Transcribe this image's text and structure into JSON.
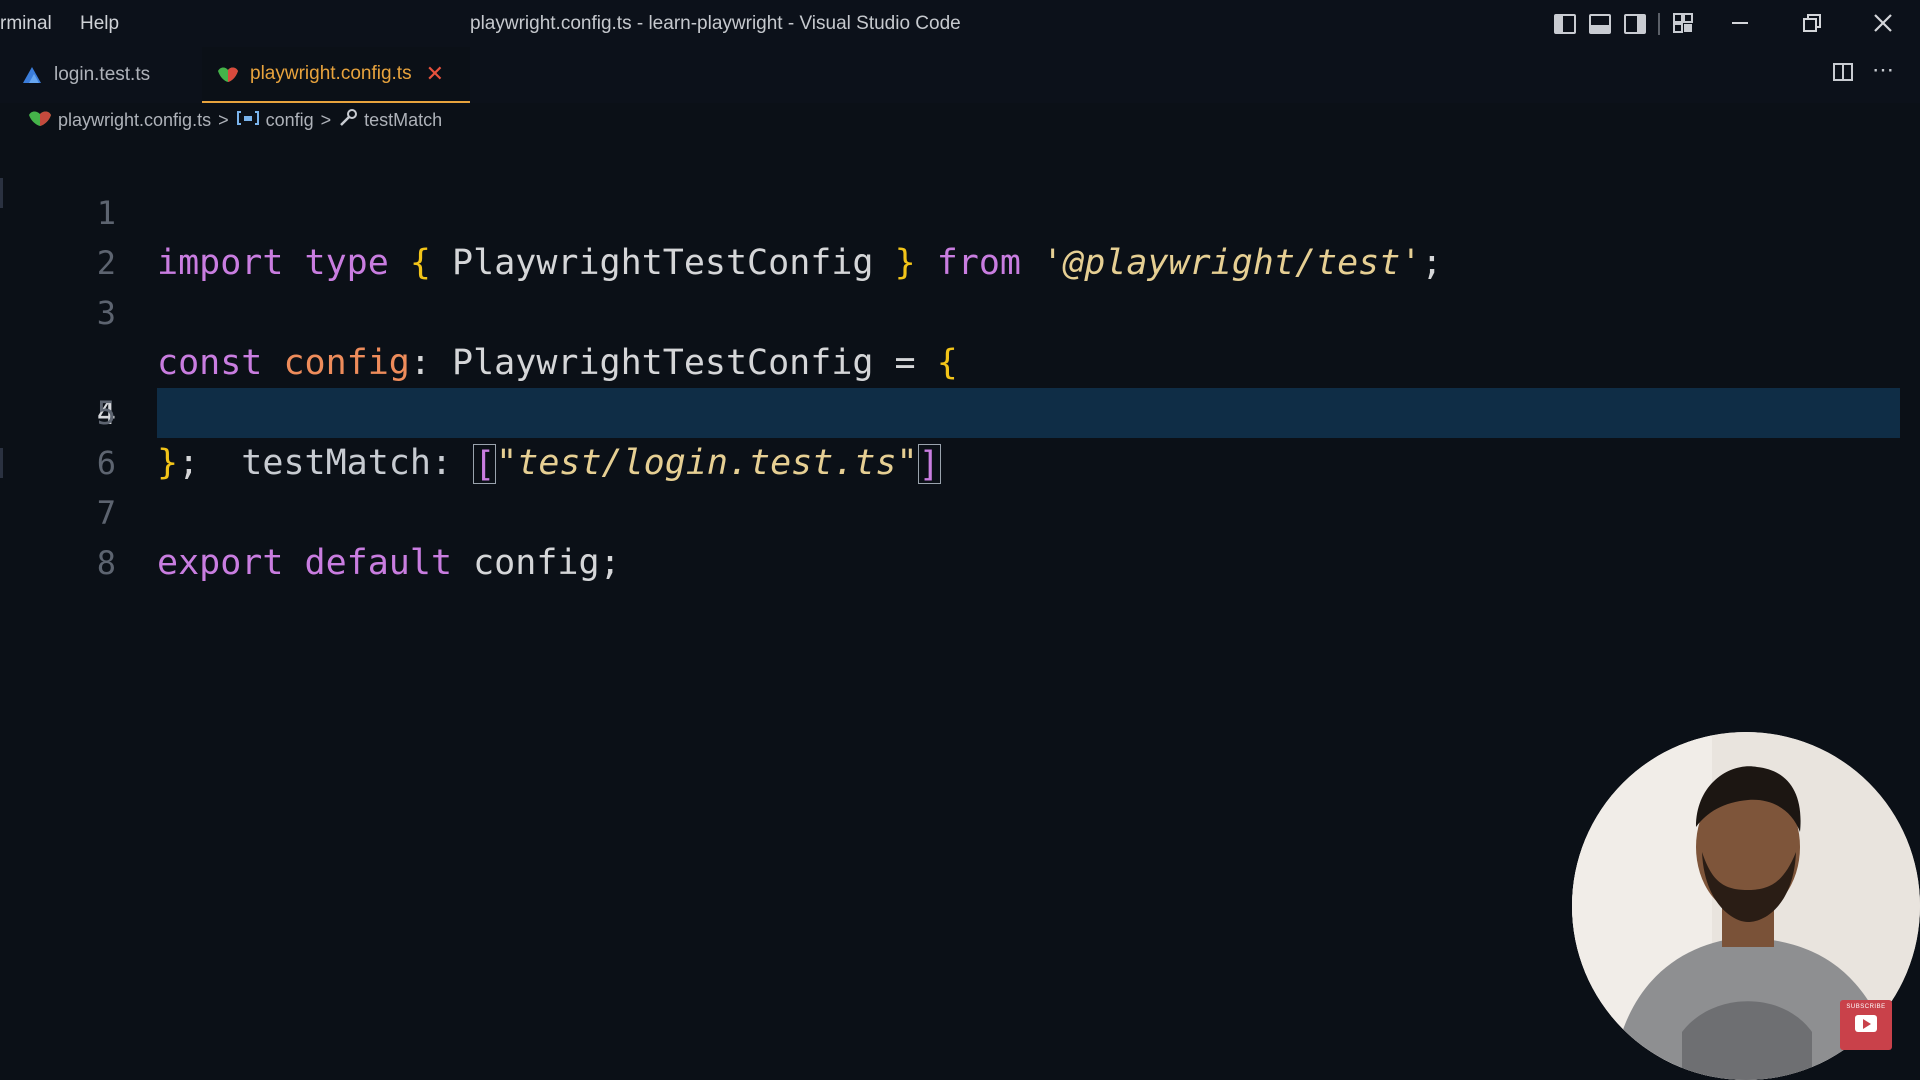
{
  "menu": {
    "terminal": "rminal",
    "help": "Help"
  },
  "window": {
    "title": "playwright.config.ts - learn-playwright - Visual Studio Code"
  },
  "tabs": [
    {
      "label": "login.test.ts",
      "icon": "test-file-icon",
      "active": false
    },
    {
      "label": "playwright.config.ts",
      "icon": "playwright-icon",
      "active": true
    }
  ],
  "breadcrumb": {
    "file": "playwright.config.ts",
    "symbol": "config",
    "property": "testMatch",
    "separator": ">"
  },
  "editor": {
    "active_line": 4,
    "line_numbers": [
      "1",
      "2",
      "3",
      "4",
      "5",
      "6",
      "7",
      "8"
    ],
    "line1": {
      "import": "import",
      "type": "type",
      "open": "{",
      "name": "PlaywrightTestConfig",
      "close": "}",
      "from": "from",
      "module": "'@playwright/test'",
      "semi": ";"
    },
    "line3": {
      "const": "const",
      "name": "config",
      "colon": ":",
      "type": "PlaywrightTestConfig",
      "eq": "=",
      "open": "{"
    },
    "line4": {
      "prop": "testMatch:",
      "lbracket": "[",
      "value": "\"test/login.test.ts\"",
      "rbracket": "]"
    },
    "line5": {
      "close": "}",
      "semi": ";"
    },
    "line7": {
      "export": "export",
      "default": "default",
      "name": "config;"
    }
  },
  "colors": {
    "background": "#0b1017",
    "accent_tab": "#e8a33d",
    "keyword": "#c97de0",
    "brace": "#f2c419",
    "variable": "#ee8c5b",
    "string": "#e6cf93",
    "line_highlight": "#0f2d46"
  },
  "overlay": {
    "webcam": "presenter-webcam",
    "subscribe_label": "SUBSCRIBE"
  }
}
